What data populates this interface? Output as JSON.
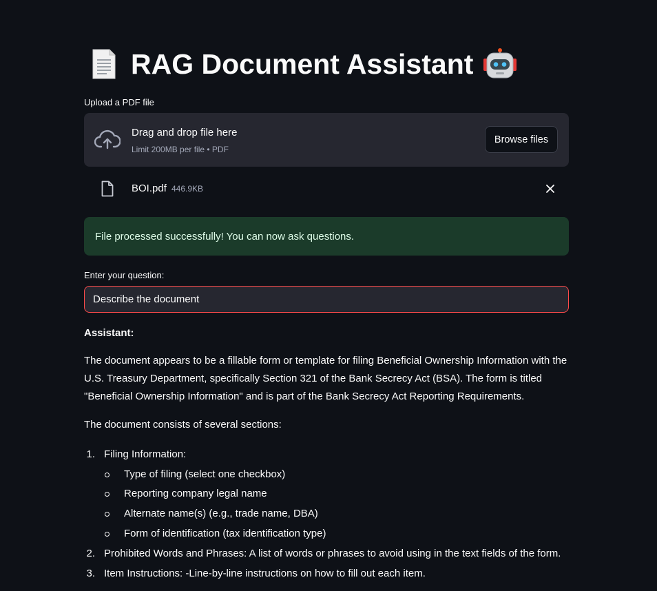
{
  "header": {
    "title": "RAG Document Assistant",
    "leading_icon": "document-icon",
    "trailing_icon": "robot-icon"
  },
  "uploader": {
    "label": "Upload a PDF file",
    "drop_text": "Drag and drop file here",
    "limit_text": "Limit 200MB per file • PDF",
    "browse_label": "Browse files",
    "icon": "cloud-upload-icon"
  },
  "uploaded_file": {
    "name": "BOI.pdf",
    "size": "446.9KB",
    "icon": "file-icon",
    "remove_icon": "close-icon"
  },
  "status": {
    "message": "File processed successfully! You can now ask questions.",
    "color": "#1b3b2a"
  },
  "question": {
    "label": "Enter your question:",
    "value": "Describe the document"
  },
  "answer": {
    "label": "Assistant:",
    "intro": "The document appears to be a fillable form or template for filing Beneficial Ownership Information with the U.S. Treasury Department, specifically Section 321 of the Bank Secrecy Act (BSA). The form is titled \"Beneficial Ownership Information\" and is part of the Bank Secrecy Act Reporting Requirements.",
    "sections_intro": "The document consists of several sections:",
    "sections": [
      {
        "number": "1.",
        "text": "Filing Information:",
        "subitems": [
          "Type of filing (select one checkbox)",
          "Reporting company legal name",
          "Alternate name(s) (e.g., trade name, DBA)",
          "Form of identification (tax identification type)"
        ]
      },
      {
        "number": "2.",
        "text": "Prohibited Words and Phrases: A list of words or phrases to avoid using in the text fields of the form."
      },
      {
        "number": "3.",
        "text": "Item Instructions: -Line-by-line instructions on how to fill out each item."
      }
    ]
  },
  "colors": {
    "background": "#0e1117",
    "surface": "#262730",
    "input_border_focus": "#ff4b4b",
    "muted_text": "#a3a8b8"
  }
}
